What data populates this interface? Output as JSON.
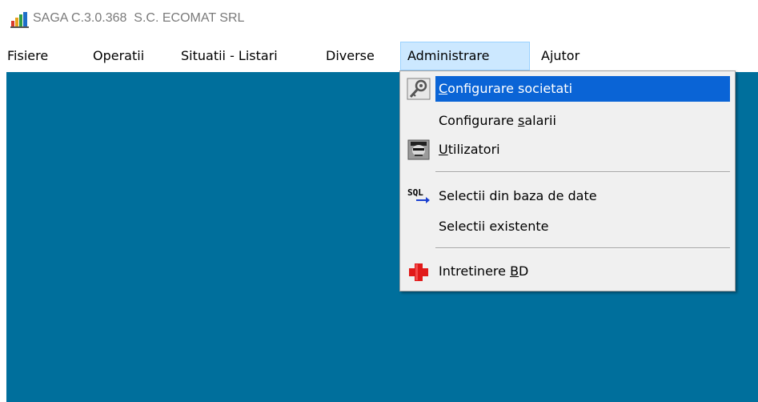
{
  "window": {
    "title": "SAGA C.3.0.368  S.C. ECOMAT SRL",
    "icon": "saga-app-icon"
  },
  "menubar": {
    "items": [
      {
        "label": "Fisiere"
      },
      {
        "label": "Operatii"
      },
      {
        "label": "Situatii - Listari"
      },
      {
        "label": "Diverse"
      },
      {
        "label": "Administrare",
        "open": true
      },
      {
        "label": "Ajutor"
      }
    ]
  },
  "dropdown": {
    "items": [
      {
        "pre": "",
        "u": "C",
        "post": "onfigurare societati",
        "icon": "key-wrench-icon",
        "highlighted": true
      },
      {
        "pre": "Configurare ",
        "u": "s",
        "post": "alarii",
        "icon": ""
      },
      {
        "pre": "",
        "u": "U",
        "post": "tilizatori",
        "icon": "user-face-icon"
      },
      {
        "pre": "Selectii din baza de date",
        "u": "",
        "post": "",
        "icon": "sql-icon",
        "sql_text": "SQL"
      },
      {
        "pre": "Selectii existente",
        "u": "",
        "post": "",
        "icon": ""
      },
      {
        "pre": "Intretinere ",
        "u": "B",
        "post": "D",
        "icon": "red-cross-icon"
      }
    ]
  },
  "colors": {
    "workspace": "#006f9c",
    "highlight": "#0a64d6",
    "menu_open_bg": "#cce8ff"
  }
}
